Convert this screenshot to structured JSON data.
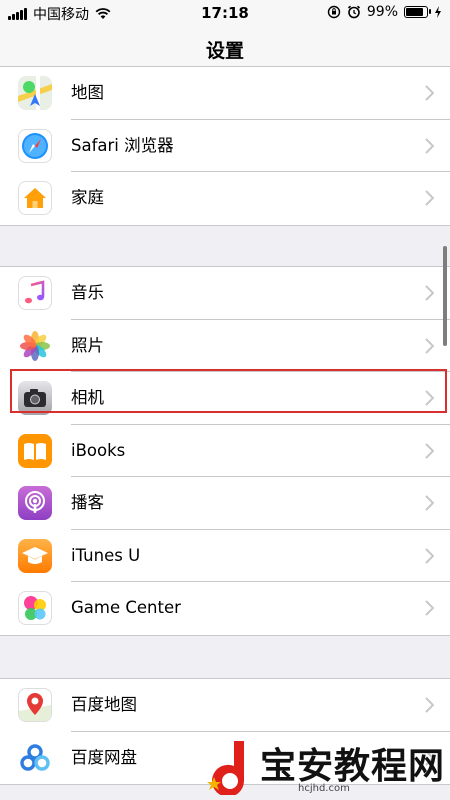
{
  "status_bar": {
    "carrier": "中国移动",
    "time": "17:18",
    "battery_percent": "99%",
    "battery_level": 0.99,
    "icons": [
      "signal-icon",
      "wifi-icon",
      "orientation-lock-icon",
      "alarm-icon",
      "battery-icon",
      "charging-icon"
    ]
  },
  "nav": {
    "title": "设置"
  },
  "groups": [
    {
      "items": [
        {
          "label": "地图",
          "icon": "maps-icon"
        },
        {
          "label": "Safari 浏览器",
          "icon": "safari-icon"
        },
        {
          "label": "家庭",
          "icon": "home-icon"
        }
      ]
    },
    {
      "items": [
        {
          "label": "音乐",
          "icon": "music-icon"
        },
        {
          "label": "照片",
          "icon": "photos-icon"
        },
        {
          "label": "相机",
          "icon": "camera-icon"
        },
        {
          "label": "iBooks",
          "icon": "ibooks-icon"
        },
        {
          "label": "播客",
          "icon": "podcasts-icon"
        },
        {
          "label": "iTunes U",
          "icon": "itunes-u-icon"
        },
        {
          "label": "Game Center",
          "icon": "game-center-icon"
        }
      ]
    },
    {
      "items": [
        {
          "label": "百度地图",
          "icon": "baidu-maps-icon"
        },
        {
          "label": "百度网盘",
          "icon": "baidu-netdisk-icon"
        }
      ]
    }
  ],
  "watermark": {
    "brand": "宝安教程网",
    "site": "hcjhd.com"
  },
  "colors": {
    "highlight": "#d9302f",
    "separator": "#c8c7cc",
    "group_background": "#efeff4"
  }
}
